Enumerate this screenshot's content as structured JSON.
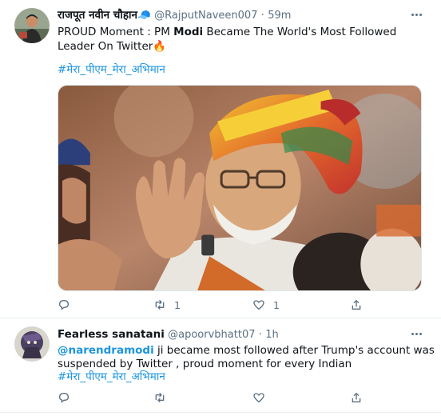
{
  "tweets": [
    {
      "name": "राजपूत नवीन चौहान",
      "name_emoji": "🧢",
      "handle": "@RajputNaveen007",
      "separator": "·",
      "time": "59m",
      "text_before": "PROUD Moment : PM ",
      "text_bold": "Modi",
      "text_after": " Became The World's Most Followed Leader On Twitter",
      "text_emoji": "🔥",
      "hashtag": "#मेरा_पीएम_मेरा_अभिमान",
      "image_icon": "photo-portrait",
      "reply_count": "",
      "retweet_count": "1",
      "like_count": "1"
    },
    {
      "name": "Fearless sanatani",
      "handle": "@apoorvbhatt07",
      "separator": "·",
      "time": "1h",
      "mention": "@narendramodi",
      "text_line1_after": " ji became most followed after Trump's account was",
      "text_line2": "suspended by Twitter , proud moment for every Indian",
      "hashtag": "#मेरा_पीएम_मेरा_अभिमान"
    }
  ],
  "icons": {
    "reply": "reply-icon",
    "retweet": "retweet-icon",
    "like": "heart-icon",
    "share": "share-icon",
    "more": "more-icon"
  },
  "colors": {
    "link": "#1b95e0",
    "secondary_text": "#5b7083",
    "divider": "#e6ecf0"
  }
}
